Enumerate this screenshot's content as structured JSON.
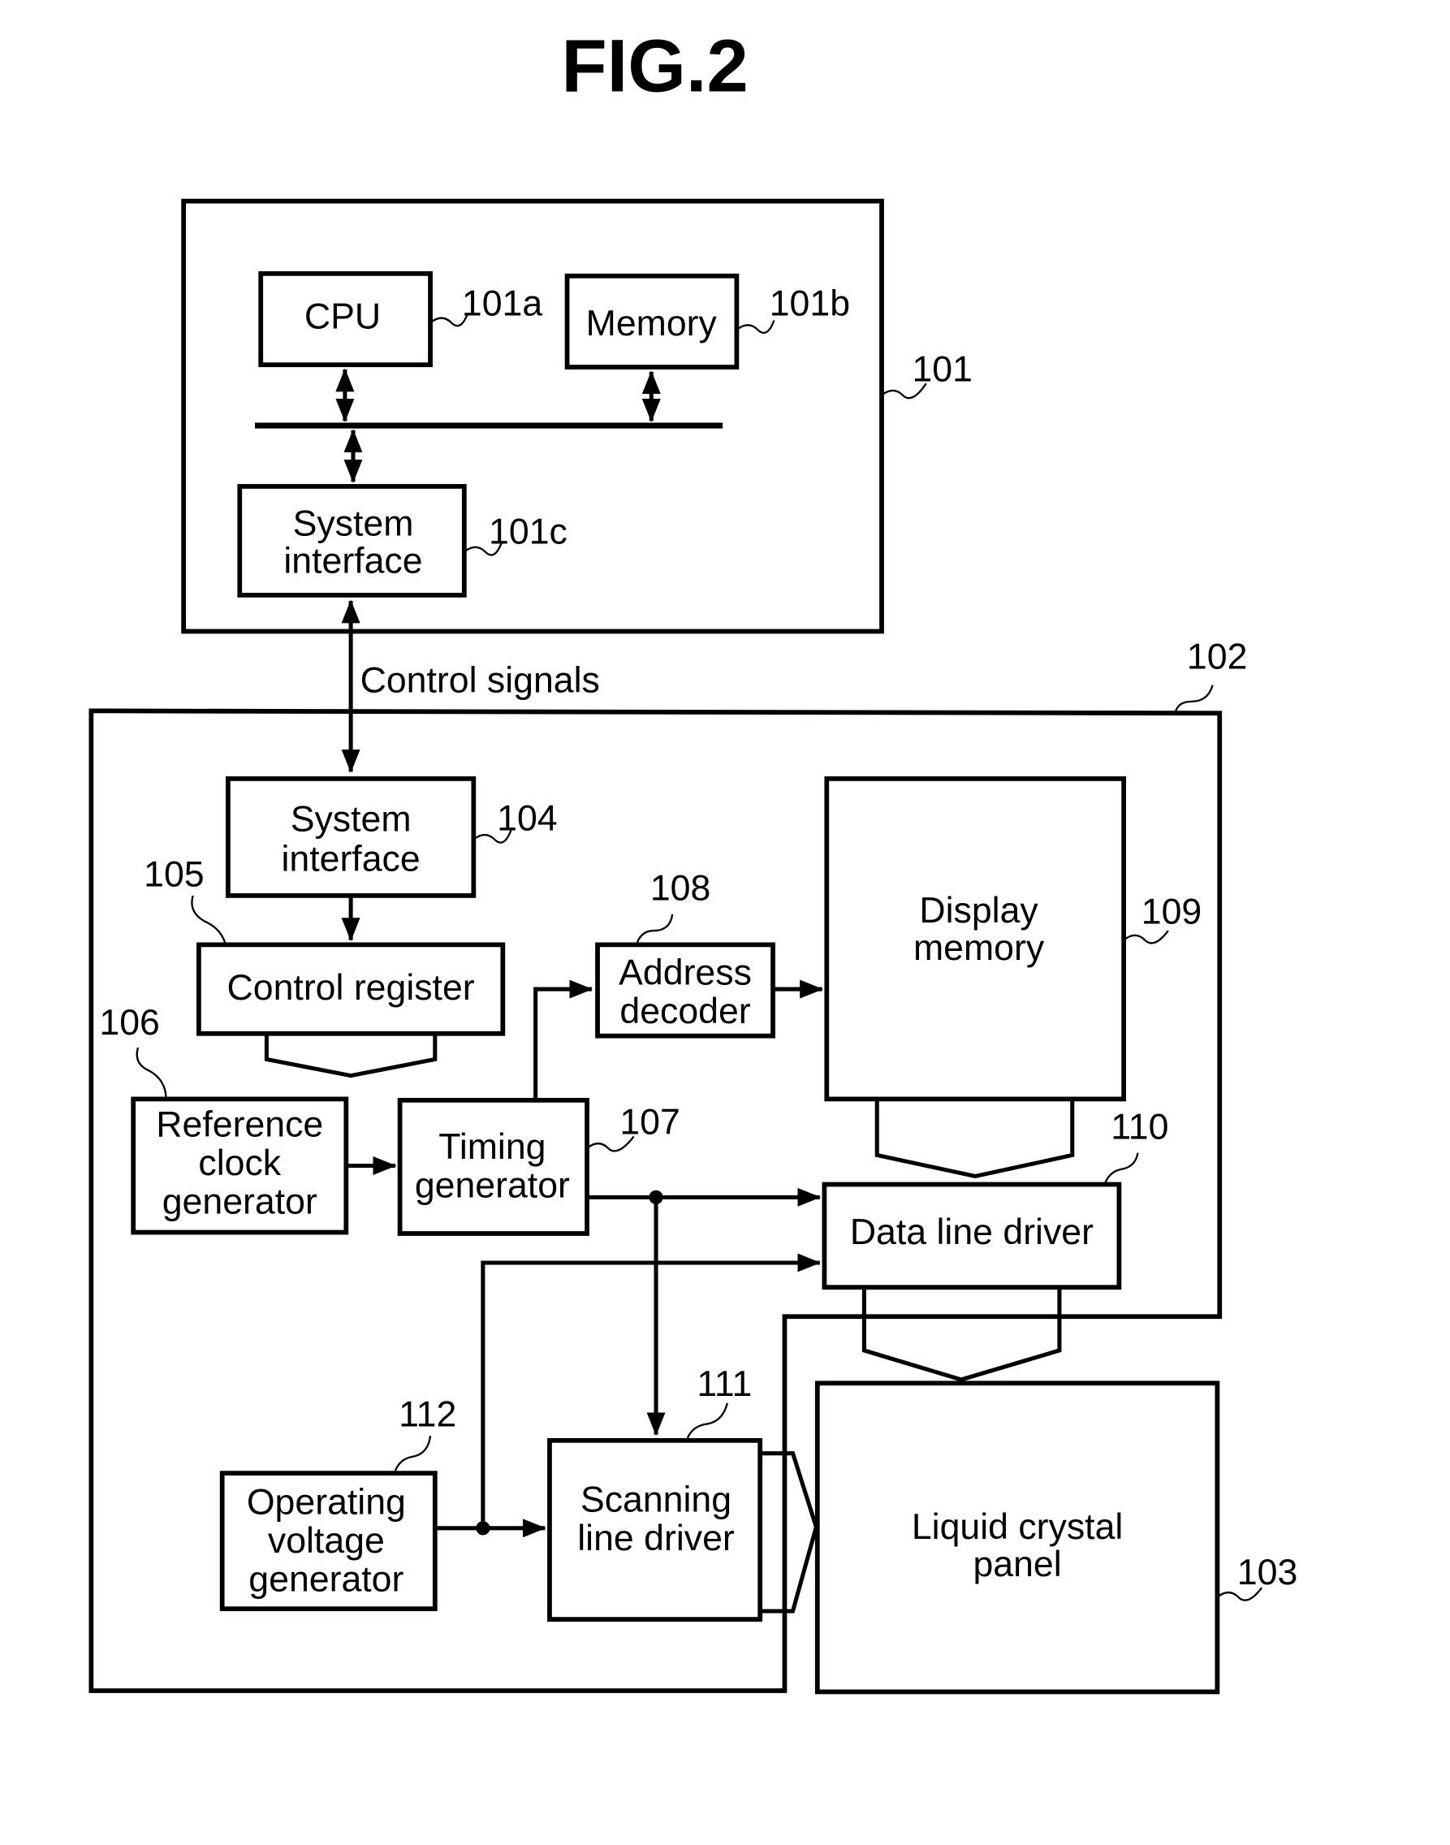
{
  "figure_title": "FIG.2",
  "signal_label": "Control signals",
  "blocks": {
    "cpu": {
      "ref": "101a",
      "lines": [
        "CPU"
      ]
    },
    "memory": {
      "ref": "101b",
      "lines": [
        "Memory"
      ]
    },
    "host_system_interface": {
      "ref": "101c",
      "lines": [
        "System",
        "interface"
      ]
    },
    "host": {
      "ref": "101"
    },
    "controller": {
      "ref": "102"
    },
    "lcd_panel": {
      "ref": "103",
      "lines": [
        "Liquid crystal",
        "panel"
      ]
    },
    "system_interface": {
      "ref": "104",
      "lines": [
        "System",
        "interface"
      ]
    },
    "control_register": {
      "ref": "105",
      "lines": [
        "Control register"
      ]
    },
    "reference_clock": {
      "ref": "106",
      "lines": [
        "Reference",
        "clock",
        "generator"
      ]
    },
    "timing_generator": {
      "ref": "107",
      "lines": [
        "Timing",
        "generator"
      ]
    },
    "address_decoder": {
      "ref": "108",
      "lines": [
        "Address",
        "decoder"
      ]
    },
    "display_memory": {
      "ref": "109",
      "lines": [
        "Display",
        "memory"
      ]
    },
    "data_line_driver": {
      "ref": "110",
      "lines": [
        "Data line driver"
      ]
    },
    "scanning_line_driver": {
      "ref": "111",
      "lines": [
        "Scanning",
        "line driver"
      ]
    },
    "operating_voltage": {
      "ref": "112",
      "lines": [
        "Operating",
        "voltage",
        "generator"
      ]
    }
  }
}
